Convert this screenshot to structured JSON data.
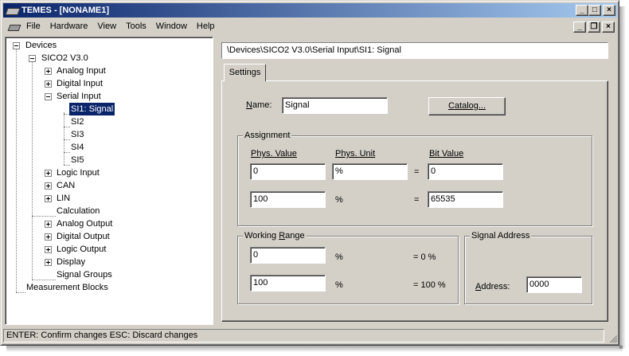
{
  "window": {
    "title": "TEMES - [NONAME1]",
    "controls": {
      "minimize": "_",
      "restore": "□",
      "close": "×"
    }
  },
  "menubar": {
    "items": [
      "File",
      "Hardware",
      "View",
      "Tools",
      "Window",
      "Help"
    ],
    "doc_controls": {
      "minimize": "_",
      "restore": "❐",
      "close": "×"
    }
  },
  "tree": {
    "devices": "Devices",
    "sico2": "SICO2 V3.0",
    "analog_input": "Analog Input",
    "digital_input": "Digital Input",
    "serial_input": "Serial Input",
    "si1": "SI1: Signal",
    "si2": "SI2",
    "si3": "SI3",
    "si4": "SI4",
    "si5": "SI5",
    "logic_input": "Logic Input",
    "can": "CAN",
    "lin": "LIN",
    "calculation": "Calculation",
    "analog_output": "Analog Output",
    "digital_output": "Digital Output",
    "logic_output": "Logic Output",
    "display": "Display",
    "signal_groups": "Signal Groups",
    "measurement_blocks": "Measurement Blocks"
  },
  "path": "\\Devices\\SICO2 V3.0\\Serial Input\\SI1: Signal",
  "tabs": {
    "settings": "Settings"
  },
  "settings": {
    "name_label": "Name:",
    "name_value": "Signal",
    "catalog_button": "Catalog...",
    "assignment": {
      "title": "Assignment",
      "phys_value_header": "Phys. Value",
      "phys_unit_header": "Phys. Unit",
      "bit_value_header": "Bit Value",
      "row1": {
        "phys_value": "0",
        "phys_unit": "%",
        "equals": "=",
        "bit_value": "0"
      },
      "row2": {
        "phys_value": "100",
        "phys_unit": "%",
        "equals": "=",
        "bit_value": "65535"
      }
    },
    "working_range": {
      "title": "Working Range",
      "row1": {
        "value": "0",
        "unit": "%",
        "result": "= 0 %"
      },
      "row2": {
        "value": "100",
        "unit": "%",
        "result": "= 100 %"
      }
    },
    "signal_address": {
      "title": "Signal Address",
      "address_label": "Address:",
      "address_value": "0000"
    }
  },
  "status": {
    "text": "ENTER: Confirm changes   ESC: Discard changes"
  }
}
